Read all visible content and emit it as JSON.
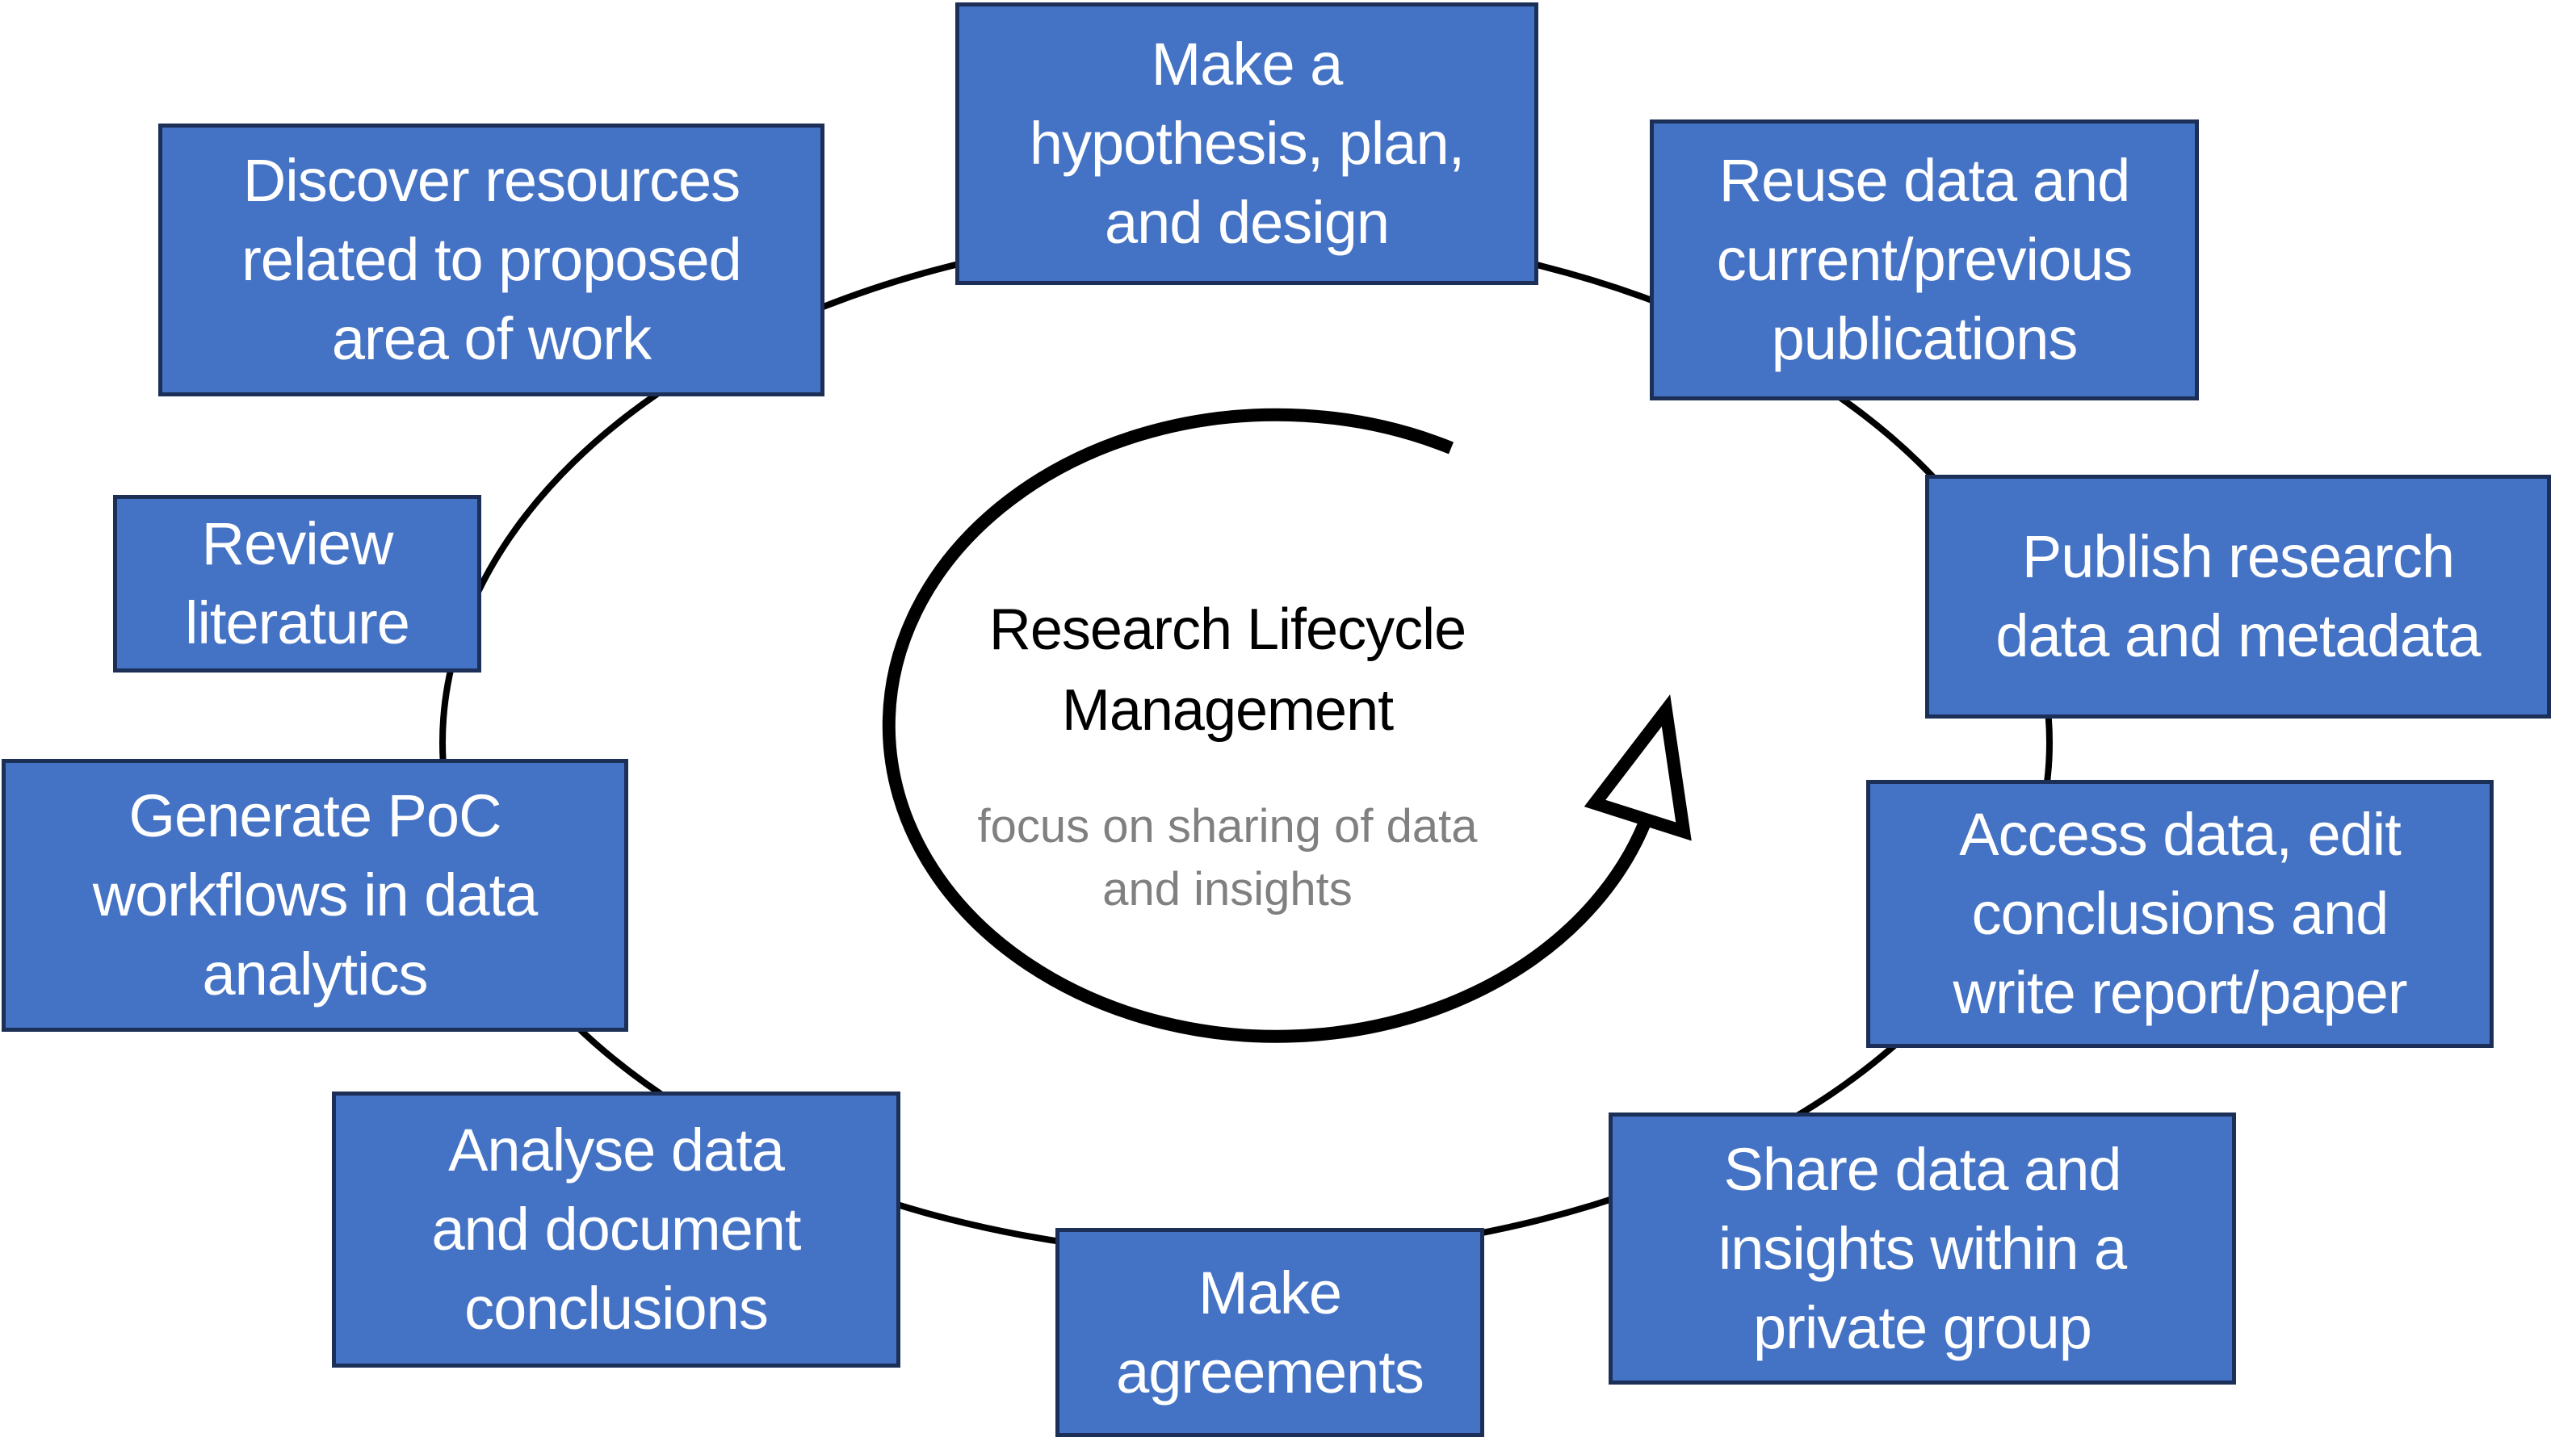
{
  "diagram": {
    "title": "Research Lifecycle Management",
    "title_lines": "Research Lifecycle\nManagement",
    "subtitle_lines": "focus on sharing of data\nand insights",
    "colors": {
      "box_fill": "#4472c4",
      "box_border": "#1c2f57",
      "box_text": "#ffffff",
      "subtitle": "#808080"
    },
    "steps": [
      {
        "id": "hypothesis",
        "label": "Make a\nhypothesis, plan,\nand design"
      },
      {
        "id": "reuse",
        "label": "Reuse data and\ncurrent/previous\npublications"
      },
      {
        "id": "publish",
        "label": "Publish research\ndata and metadata"
      },
      {
        "id": "access",
        "label": "Access data, edit\nconclusions and\nwrite report/paper"
      },
      {
        "id": "share",
        "label": "Share data and\ninsights within a\nprivate group"
      },
      {
        "id": "agreements",
        "label": "Make\nagreements"
      },
      {
        "id": "analyse",
        "label": "Analyse data\nand document\nconclusions"
      },
      {
        "id": "poc",
        "label": "Generate PoC\nworkflows in data\nanalytics"
      },
      {
        "id": "review",
        "label": "Review\nliterature"
      },
      {
        "id": "discover",
        "label": "Discover resources\nrelated to proposed\narea of work"
      }
    ]
  }
}
